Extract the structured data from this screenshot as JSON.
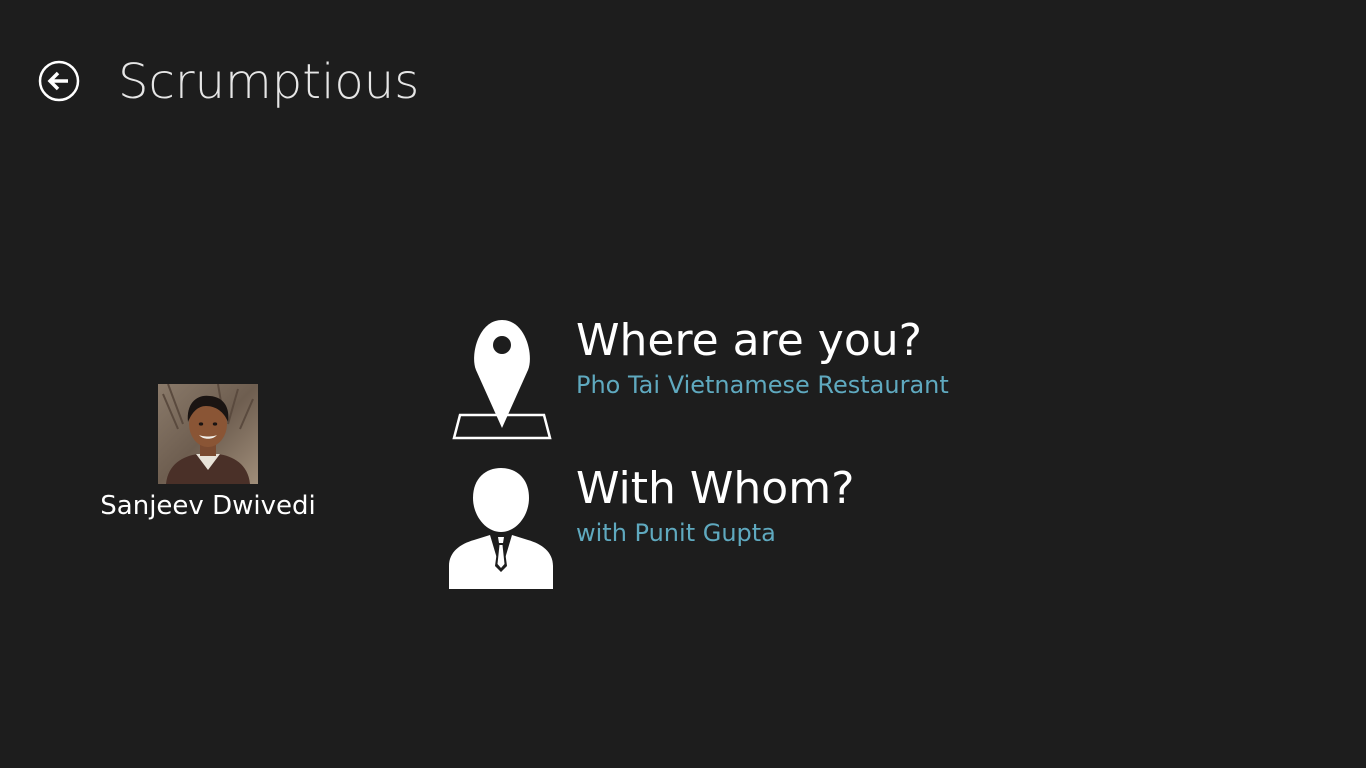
{
  "header": {
    "title": "Scrumptious",
    "back_icon": "back-arrow-circle-icon"
  },
  "profile": {
    "name": "Sanjeev Dwivedi",
    "avatar_icon": "user-photo"
  },
  "actions": [
    {
      "heading": "Where are you?",
      "value": "Pho Tai Vietnamese Restaurant",
      "icon": "map-pin-icon"
    },
    {
      "heading": "With Whom?",
      "value": "with Punit Gupta",
      "icon": "person-icon"
    }
  ],
  "colors": {
    "background": "#1d1d1d",
    "accent": "#5fa9bf",
    "text": "#ffffff"
  }
}
